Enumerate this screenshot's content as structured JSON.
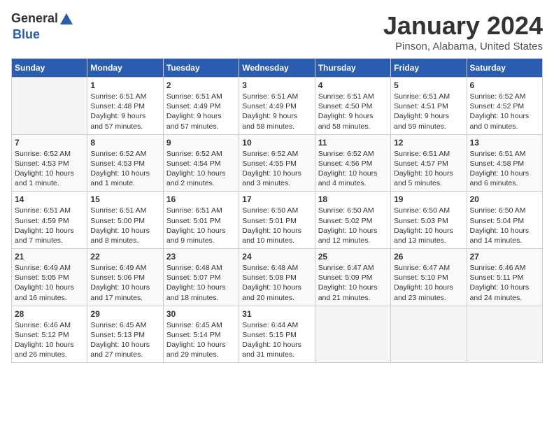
{
  "header": {
    "logo_general": "General",
    "logo_blue": "Blue",
    "month": "January 2024",
    "location": "Pinson, Alabama, United States"
  },
  "calendar": {
    "days_of_week": [
      "Sunday",
      "Monday",
      "Tuesday",
      "Wednesday",
      "Thursday",
      "Friday",
      "Saturday"
    ],
    "weeks": [
      [
        {
          "num": "",
          "info": ""
        },
        {
          "num": "1",
          "info": "Sunrise: 6:51 AM\nSunset: 4:48 PM\nDaylight: 9 hours\nand 57 minutes."
        },
        {
          "num": "2",
          "info": "Sunrise: 6:51 AM\nSunset: 4:49 PM\nDaylight: 9 hours\nand 57 minutes."
        },
        {
          "num": "3",
          "info": "Sunrise: 6:51 AM\nSunset: 4:49 PM\nDaylight: 9 hours\nand 58 minutes."
        },
        {
          "num": "4",
          "info": "Sunrise: 6:51 AM\nSunset: 4:50 PM\nDaylight: 9 hours\nand 58 minutes."
        },
        {
          "num": "5",
          "info": "Sunrise: 6:51 AM\nSunset: 4:51 PM\nDaylight: 9 hours\nand 59 minutes."
        },
        {
          "num": "6",
          "info": "Sunrise: 6:52 AM\nSunset: 4:52 PM\nDaylight: 10 hours\nand 0 minutes."
        }
      ],
      [
        {
          "num": "7",
          "info": "Sunrise: 6:52 AM\nSunset: 4:53 PM\nDaylight: 10 hours\nand 1 minute."
        },
        {
          "num": "8",
          "info": "Sunrise: 6:52 AM\nSunset: 4:53 PM\nDaylight: 10 hours\nand 1 minute."
        },
        {
          "num": "9",
          "info": "Sunrise: 6:52 AM\nSunset: 4:54 PM\nDaylight: 10 hours\nand 2 minutes."
        },
        {
          "num": "10",
          "info": "Sunrise: 6:52 AM\nSunset: 4:55 PM\nDaylight: 10 hours\nand 3 minutes."
        },
        {
          "num": "11",
          "info": "Sunrise: 6:52 AM\nSunset: 4:56 PM\nDaylight: 10 hours\nand 4 minutes."
        },
        {
          "num": "12",
          "info": "Sunrise: 6:51 AM\nSunset: 4:57 PM\nDaylight: 10 hours\nand 5 minutes."
        },
        {
          "num": "13",
          "info": "Sunrise: 6:51 AM\nSunset: 4:58 PM\nDaylight: 10 hours\nand 6 minutes."
        }
      ],
      [
        {
          "num": "14",
          "info": "Sunrise: 6:51 AM\nSunset: 4:59 PM\nDaylight: 10 hours\nand 7 minutes."
        },
        {
          "num": "15",
          "info": "Sunrise: 6:51 AM\nSunset: 5:00 PM\nDaylight: 10 hours\nand 8 minutes."
        },
        {
          "num": "16",
          "info": "Sunrise: 6:51 AM\nSunset: 5:01 PM\nDaylight: 10 hours\nand 9 minutes."
        },
        {
          "num": "17",
          "info": "Sunrise: 6:50 AM\nSunset: 5:01 PM\nDaylight: 10 hours\nand 10 minutes."
        },
        {
          "num": "18",
          "info": "Sunrise: 6:50 AM\nSunset: 5:02 PM\nDaylight: 10 hours\nand 12 minutes."
        },
        {
          "num": "19",
          "info": "Sunrise: 6:50 AM\nSunset: 5:03 PM\nDaylight: 10 hours\nand 13 minutes."
        },
        {
          "num": "20",
          "info": "Sunrise: 6:50 AM\nSunset: 5:04 PM\nDaylight: 10 hours\nand 14 minutes."
        }
      ],
      [
        {
          "num": "21",
          "info": "Sunrise: 6:49 AM\nSunset: 5:05 PM\nDaylight: 10 hours\nand 16 minutes."
        },
        {
          "num": "22",
          "info": "Sunrise: 6:49 AM\nSunset: 5:06 PM\nDaylight: 10 hours\nand 17 minutes."
        },
        {
          "num": "23",
          "info": "Sunrise: 6:48 AM\nSunset: 5:07 PM\nDaylight: 10 hours\nand 18 minutes."
        },
        {
          "num": "24",
          "info": "Sunrise: 6:48 AM\nSunset: 5:08 PM\nDaylight: 10 hours\nand 20 minutes."
        },
        {
          "num": "25",
          "info": "Sunrise: 6:47 AM\nSunset: 5:09 PM\nDaylight: 10 hours\nand 21 minutes."
        },
        {
          "num": "26",
          "info": "Sunrise: 6:47 AM\nSunset: 5:10 PM\nDaylight: 10 hours\nand 23 minutes."
        },
        {
          "num": "27",
          "info": "Sunrise: 6:46 AM\nSunset: 5:11 PM\nDaylight: 10 hours\nand 24 minutes."
        }
      ],
      [
        {
          "num": "28",
          "info": "Sunrise: 6:46 AM\nSunset: 5:12 PM\nDaylight: 10 hours\nand 26 minutes."
        },
        {
          "num": "29",
          "info": "Sunrise: 6:45 AM\nSunset: 5:13 PM\nDaylight: 10 hours\nand 27 minutes."
        },
        {
          "num": "30",
          "info": "Sunrise: 6:45 AM\nSunset: 5:14 PM\nDaylight: 10 hours\nand 29 minutes."
        },
        {
          "num": "31",
          "info": "Sunrise: 6:44 AM\nSunset: 5:15 PM\nDaylight: 10 hours\nand 31 minutes."
        },
        {
          "num": "",
          "info": ""
        },
        {
          "num": "",
          "info": ""
        },
        {
          "num": "",
          "info": ""
        }
      ]
    ]
  }
}
